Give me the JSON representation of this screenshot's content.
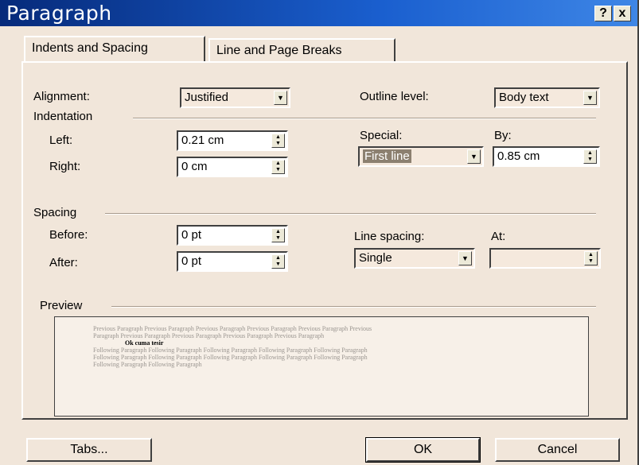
{
  "window": {
    "title": "Paragraph",
    "help_btn": "?",
    "close_btn": "x"
  },
  "tabs": {
    "active": "Indents and Spacing",
    "inactive": "Line and Page Breaks"
  },
  "general": {
    "alignment_label": "Alignment:",
    "alignment_value": "Justified",
    "outline_label": "Outline level:",
    "outline_value": "Body text"
  },
  "indentation": {
    "group_label": "Indentation",
    "left_label": "Left:",
    "left_value": "0.21 cm",
    "right_label": "Right:",
    "right_value": "0 cm",
    "special_label": "Special:",
    "special_value": "First line",
    "by_label": "By:",
    "by_value": "0.85 cm"
  },
  "spacing": {
    "group_label": "Spacing",
    "before_label": "Before:",
    "before_value": "0 pt",
    "after_label": "After:",
    "after_value": "0 pt",
    "line_spacing_label": "Line spacing:",
    "line_spacing_value": "Single",
    "at_label": "At:",
    "at_value": ""
  },
  "preview": {
    "group_label": "Preview",
    "prev_line1": "Previous Paragraph Previous Paragraph Previous Paragraph Previous Paragraph Previous Paragraph Previous",
    "prev_line2": "Paragraph Previous Paragraph Previous Paragraph Previous Paragraph Previous Paragraph",
    "current": "Ok cuma tesir",
    "follow_line1": "Following Paragraph Following Paragraph Following Paragraph Following Paragraph Following Paragraph",
    "follow_line2": "Following Paragraph Following Paragraph Following Paragraph Following Paragraph Following Paragraph",
    "follow_line3": "Following Paragraph Following Paragraph"
  },
  "buttons": {
    "tabs": "Tabs...",
    "ok": "OK",
    "cancel": "Cancel"
  },
  "icons": {
    "dropdown": "chevron-down-icon",
    "spinner": "spinner-icon"
  }
}
